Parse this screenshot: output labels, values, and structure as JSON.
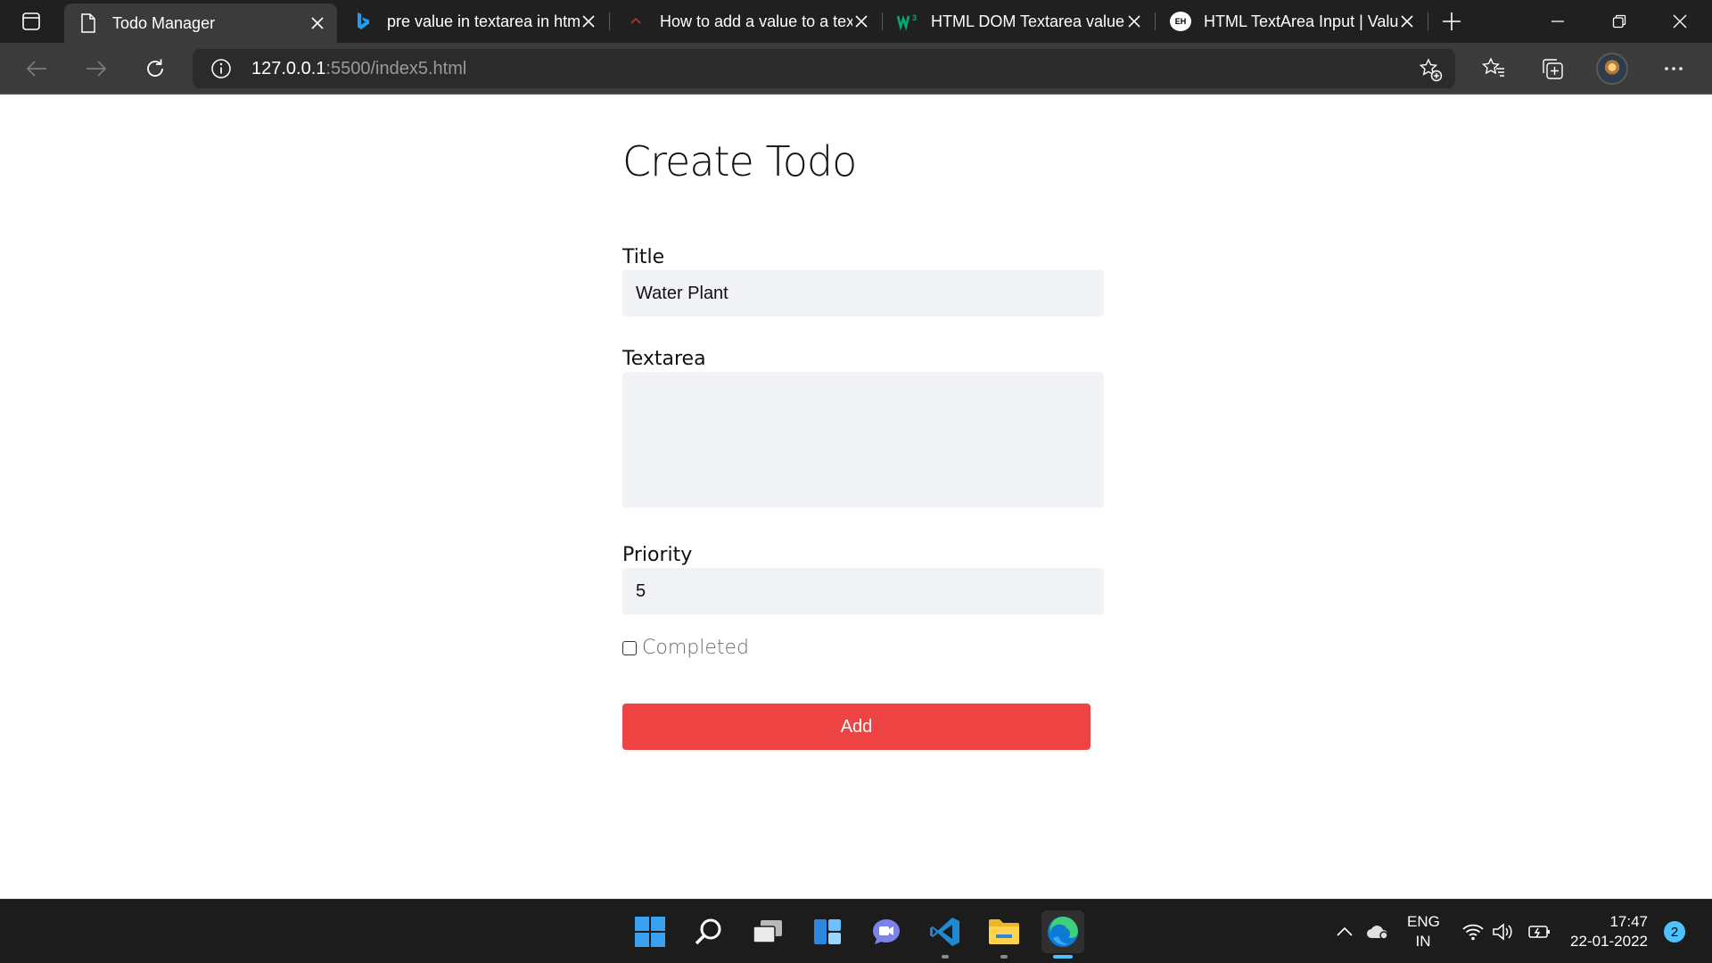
{
  "browser": {
    "tabs": [
      {
        "title": "Todo Manager",
        "icon": "page-icon",
        "active": true
      },
      {
        "title": "pre value in textarea in html",
        "icon": "bing-icon",
        "active": false
      },
      {
        "title": "How to add a value to a textarea",
        "icon": "site-icon",
        "active": false
      },
      {
        "title": "HTML DOM Textarea value",
        "icon": "w3schools-icon",
        "active": false
      },
      {
        "title": "HTML TextArea Input | Value",
        "icon": "eh-icon",
        "active": false
      }
    ],
    "eh_logo": "EH",
    "address": {
      "host": "127.0.0.1",
      "rest": ":5500/index5.html"
    }
  },
  "page": {
    "title": "Create Todo",
    "fields": {
      "title_label": "Title",
      "title_value": "Water Plant",
      "textarea_label": "Textarea",
      "textarea_value": "",
      "priority_label": "Priority",
      "priority_value": "5"
    },
    "completed_label": "Completed",
    "completed_checked": false,
    "add_button": "Add"
  },
  "taskbar": {
    "apps": [
      "start-icon",
      "search-icon",
      "task-view-icon",
      "widgets-icon",
      "chat-icon",
      "vscode-icon",
      "file-explorer-icon",
      "edge-icon"
    ],
    "lang_line1": "ENG",
    "lang_line2": "IN",
    "time": "17:47",
    "date": "22-01-2022",
    "notifications": "2"
  },
  "colors": {
    "accent": "#ef4444",
    "input_bg": "#f0f2f6",
    "taskbar_accent": "#4cc2ff"
  }
}
